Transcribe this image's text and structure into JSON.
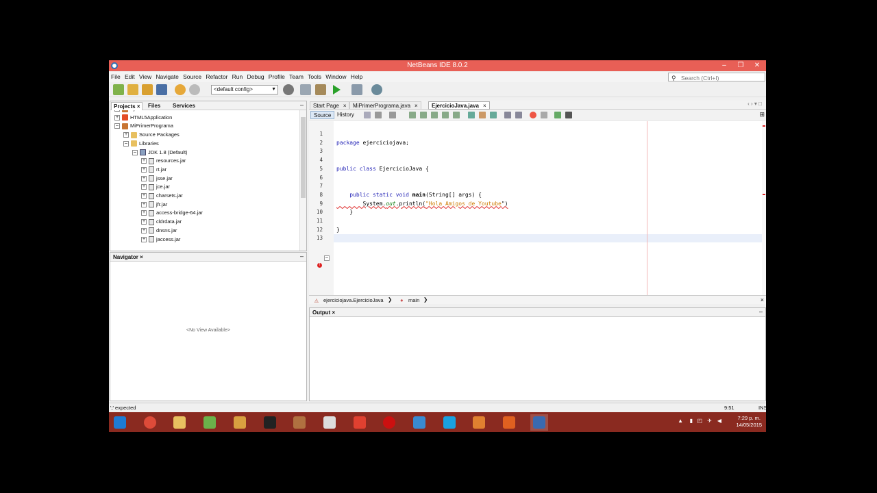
{
  "window": {
    "title": "NetBeans IDE 8.0.2",
    "minimize": "–",
    "maximize": "❐",
    "close": "✕"
  },
  "menu": [
    "File",
    "Edit",
    "View",
    "Navigate",
    "Source",
    "Refactor",
    "Run",
    "Debug",
    "Profile",
    "Team",
    "Tools",
    "Window",
    "Help"
  ],
  "search": {
    "placeholder": "Search (Ctrl+I)"
  },
  "toolbar": {
    "config": "<default config>"
  },
  "projects": {
    "tabs": [
      "Projects",
      "Files",
      "Services"
    ],
    "close": "×",
    "minimize": "–",
    "tree": [
      {
        "label": "EjercicioJava",
        "indent": 0,
        "toggle": "+",
        "icon": "proj"
      },
      {
        "label": "HTML5Application",
        "indent": 0,
        "toggle": "+",
        "icon": "html"
      },
      {
        "label": "MiPrimerPrograma",
        "indent": 0,
        "toggle": "–",
        "icon": "proj"
      },
      {
        "label": "Source Packages",
        "indent": 1,
        "toggle": "+",
        "icon": "folder"
      },
      {
        "label": "Libraries",
        "indent": 1,
        "toggle": "–",
        "icon": "folder"
      },
      {
        "label": "JDK 1.8 (Default)",
        "indent": 2,
        "toggle": "–",
        "icon": "jdk"
      },
      {
        "label": "resources.jar",
        "indent": 3,
        "toggle": "+",
        "icon": "jar"
      },
      {
        "label": "rt.jar",
        "indent": 3,
        "toggle": "+",
        "icon": "jar"
      },
      {
        "label": "jsse.jar",
        "indent": 3,
        "toggle": "+",
        "icon": "jar"
      },
      {
        "label": "jce.jar",
        "indent": 3,
        "toggle": "+",
        "icon": "jar"
      },
      {
        "label": "charsets.jar",
        "indent": 3,
        "toggle": "+",
        "icon": "jar"
      },
      {
        "label": "jfr.jar",
        "indent": 3,
        "toggle": "+",
        "icon": "jar"
      },
      {
        "label": "access-bridge-64.jar",
        "indent": 3,
        "toggle": "+",
        "icon": "jar"
      },
      {
        "label": "cldrdata.jar",
        "indent": 3,
        "toggle": "+",
        "icon": "jar"
      },
      {
        "label": "dnsns.jar",
        "indent": 3,
        "toggle": "+",
        "icon": "jar"
      },
      {
        "label": "jaccess.jar",
        "indent": 3,
        "toggle": "+",
        "icon": "jar"
      }
    ]
  },
  "navigator": {
    "title": "Navigator",
    "close": "×",
    "minimize": "–",
    "empty": "<No View Available>"
  },
  "editor": {
    "tabs": [
      {
        "label": "Start Page",
        "active": false
      },
      {
        "label": "MiPrimerPrograma.java",
        "active": false
      },
      {
        "label": "EjercicioJava.java",
        "active": true
      }
    ],
    "tab_close": "×",
    "source_label": "Source",
    "history_label": "History",
    "lines": [
      {
        "n": "1",
        "html": ""
      },
      {
        "n": "2",
        "html": "<span class=\"kw\">package</span> ejerciciojava;"
      },
      {
        "n": "3",
        "html": ""
      },
      {
        "n": "4",
        "html": ""
      },
      {
        "n": "5",
        "html": "<span class=\"kw\">public class</span> EjercicioJava {"
      },
      {
        "n": "6",
        "html": ""
      },
      {
        "n": "7",
        "html": ""
      },
      {
        "n": "8",
        "html": "    <span class=\"kw\">public static void</span> <b>main</b>(String[] args) {"
      },
      {
        "n": "9",
        "html": "        System.<span class=\"fld\">out</span>.println(<span class=\"str\">\"Hola Amigos de Youtube</span>\")"
      },
      {
        "n": "10",
        "html": "    }"
      },
      {
        "n": "11",
        "html": ""
      },
      {
        "n": "12",
        "html": "}"
      },
      {
        "n": "13",
        "html": ""
      }
    ],
    "breadcrumb": [
      "ejerciciojava.EjercicioJava",
      "main"
    ],
    "breadcrumb_sep": "❯",
    "close": "×"
  },
  "output": {
    "title": "Output",
    "close": "×",
    "minimize": "–"
  },
  "status": {
    "message": "';' expected",
    "position": "9:51",
    "mode": "INS"
  },
  "taskbar": {
    "apps": [
      "start",
      "chrome",
      "explorer",
      "notepad",
      "game",
      "skull",
      "person",
      "figure",
      "grid",
      "opera",
      "app3d",
      "skype",
      "media",
      "orange",
      "netbeans"
    ],
    "time": "7:29 p. m.",
    "date": "14/05/2015"
  }
}
